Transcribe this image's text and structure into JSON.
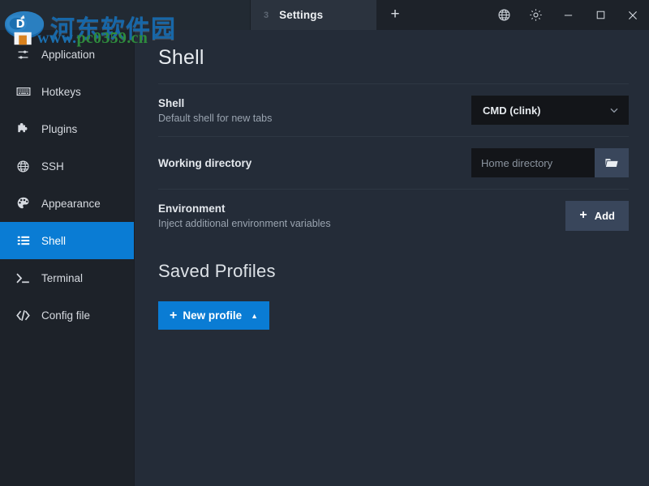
{
  "window": {
    "controls": {
      "globe_icon": "globe-icon",
      "gear_icon": "gear-icon",
      "minimize": "–",
      "maximize": "☐",
      "close": "✕"
    }
  },
  "tabbar": {
    "tabs": [
      {
        "index": "3",
        "label": "Settings",
        "active": true
      }
    ],
    "new_tab_label": "+"
  },
  "sidebar": {
    "items": [
      {
        "label": "Application",
        "icon": "sliders-icon",
        "active": false
      },
      {
        "label": "Hotkeys",
        "icon": "keyboard-icon",
        "active": false
      },
      {
        "label": "Plugins",
        "icon": "puzzle-piece-icon",
        "active": false
      },
      {
        "label": "SSH",
        "icon": "globe-icon",
        "active": false
      },
      {
        "label": "Appearance",
        "icon": "palette-icon",
        "active": false
      },
      {
        "label": "Shell",
        "icon": "list-icon",
        "active": true
      },
      {
        "label": "Terminal",
        "icon": "prompt-icon",
        "active": false
      },
      {
        "label": "Config file",
        "icon": "code-icon",
        "active": false
      }
    ]
  },
  "main": {
    "page_title": "Shell",
    "settings": [
      {
        "name": "Shell",
        "description": "Default shell for new tabs",
        "control": "select",
        "value": "CMD (clink)"
      },
      {
        "name": "Working directory",
        "description": "",
        "control": "input",
        "value": "",
        "placeholder": "Home directory",
        "button_icon": "folder-open-icon"
      },
      {
        "name": "Environment",
        "description": "Inject additional environment variables",
        "control": "button",
        "button_label": "Add",
        "button_icon": "plus-icon"
      }
    ],
    "section_title": "Saved Profiles",
    "new_profile_label": "New profile",
    "new_profile_caret": "▲"
  },
  "watermark": {
    "cn_text": "河东软件园",
    "url_prefix": "www.",
    "url_text": "pc0359.cn"
  },
  "colors": {
    "accent_blue": "#0a7cd4",
    "sidebar_bg": "#1d2229",
    "content_bg": "#242c38",
    "field_bg": "#131519",
    "slate_btn": "#39465b",
    "watermark_blue": "#1767a8",
    "watermark_green": "#2e8b3d"
  }
}
